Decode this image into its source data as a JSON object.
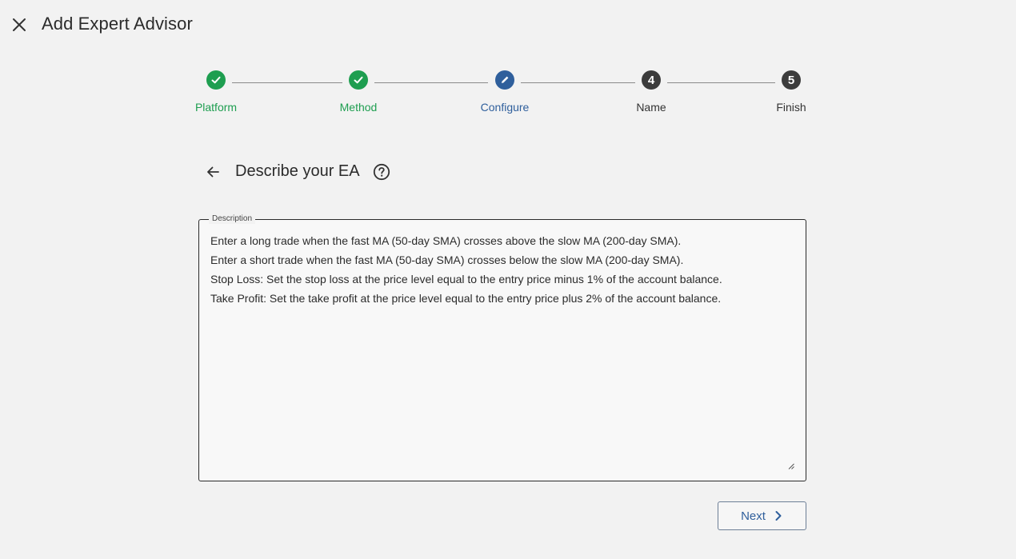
{
  "header": {
    "title": "Add Expert Advisor",
    "close_icon": "close-icon"
  },
  "stepper": {
    "steps": [
      {
        "label": "Platform",
        "state": "done",
        "icon": "check-icon"
      },
      {
        "label": "Method",
        "state": "done",
        "icon": "check-icon"
      },
      {
        "label": "Configure",
        "state": "active",
        "icon": "pencil-icon"
      },
      {
        "label": "Name",
        "state": "pending",
        "number": "4"
      },
      {
        "label": "Finish",
        "state": "pending",
        "number": "5"
      }
    ],
    "colors": {
      "done": "#1e9e50",
      "active": "#2f5f9c",
      "pending": "#3c3c3c"
    }
  },
  "section": {
    "title": "Describe your EA",
    "back_icon": "arrow-left-icon",
    "help_icon": "help-circle-icon"
  },
  "description": {
    "label": "Description",
    "value": "Enter a long trade when the fast MA (50-day SMA) crosses above the slow MA (200-day SMA).\nEnter a short trade when the fast MA (50-day SMA) crosses below the slow MA (200-day SMA).\nStop Loss: Set the stop loss at the price level equal to the entry price minus 1% of the account balance.\nTake Profit: Set the take profit at the price level equal to the entry price plus 2% of the account balance."
  },
  "footer": {
    "next_label": "Next",
    "next_icon": "chevron-right-icon"
  }
}
